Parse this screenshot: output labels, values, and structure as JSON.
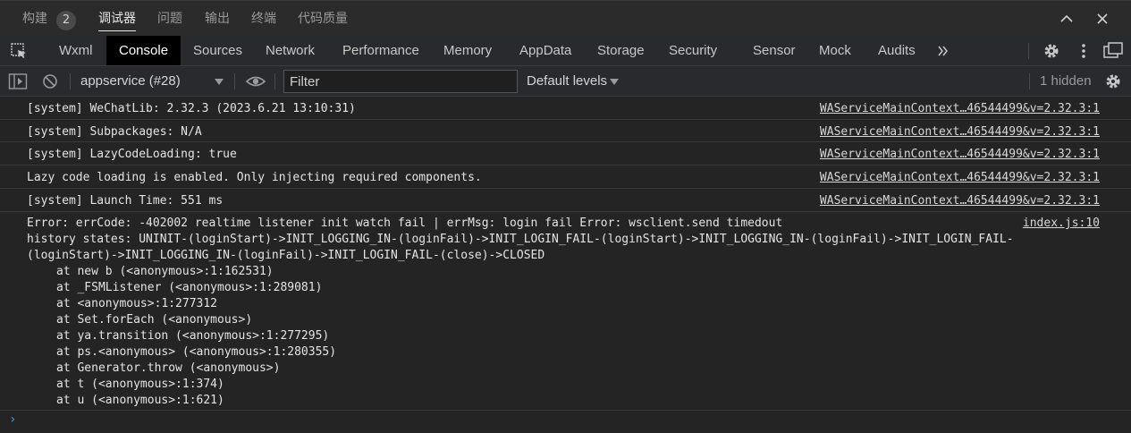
{
  "panel_tabs": {
    "build_label": "构建",
    "build_badge": "2",
    "debugger_label": "调试器",
    "issues_label": "问题",
    "output_label": "输出",
    "terminal_label": "终端",
    "quality_label": "代码质量"
  },
  "devtools_tabs": [
    "Wxml",
    "Console",
    "Sources",
    "Network",
    "Performance",
    "Memory",
    "AppData",
    "Storage",
    "Security",
    "Sensor",
    "Mock",
    "Audits"
  ],
  "devtools_active": "Console",
  "console_toolbar": {
    "context": "appservice (#28)",
    "filter_placeholder": "Filter",
    "levels": "Default levels",
    "hidden": "1 hidden"
  },
  "messages": [
    {
      "text": "[system] WeChatLib: 2.32.3 (2023.6.21 13:10:31)",
      "source": "WAServiceMainContext…46544499&v=2.32.3:1"
    },
    {
      "text": "[system] Subpackages: N/A",
      "source": "WAServiceMainContext…46544499&v=2.32.3:1"
    },
    {
      "text": "[system] LazyCodeLoading: true",
      "source": "WAServiceMainContext…46544499&v=2.32.3:1"
    },
    {
      "text": "Lazy code loading is enabled. Only injecting required components.",
      "source": "WAServiceMainContext…46544499&v=2.32.3:1"
    },
    {
      "text": "[system] Launch Time: 551 ms",
      "source": "WAServiceMainContext…46544499&v=2.32.3:1"
    }
  ],
  "error": {
    "lines": [
      "Error: errCode: -402002 realtime listener init watch fail | errMsg: login fail Error: wsclient.send timedout",
      "history states: UNINIT-(loginStart)->INIT_LOGGING_IN-(loginFail)->INIT_LOGIN_FAIL-(loginStart)->INIT_LOGGING_IN-(loginFail)->INIT_LOGIN_FAIL-",
      "(loginStart)->INIT_LOGGING_IN-(loginFail)->INIT_LOGIN_FAIL-(close)->CLOSED"
    ],
    "source": "index.js:10",
    "stack": [
      "at new b (<anonymous>:1:162531)",
      "at _FSMListener (<anonymous>:1:289081)",
      "at <anonymous>:1:277312",
      "at Set.forEach (<anonymous>)",
      "at ya.transition (<anonymous>:1:277295)",
      "at ps.<anonymous> (<anonymous>:1:280355)",
      "at Generator.throw (<anonymous>)",
      "at t (<anonymous>:1:374)",
      "at u (<anonymous>:1:621)"
    ]
  },
  "prompt_symbol": "›",
  "colors": {
    "prompt": "#3d9be9",
    "active_tab_bg": "#000000"
  }
}
